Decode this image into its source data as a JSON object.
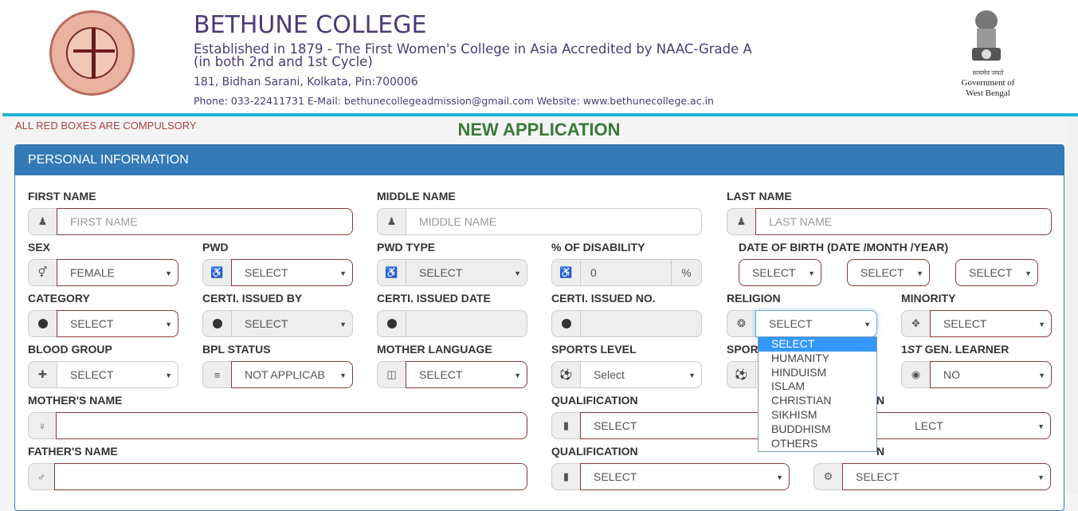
{
  "header": {
    "title": "BETHUNE COLLEGE",
    "subtitle": "Established in 1879 - The First Women's College in Asia Accredited by NAAC-Grade A (in both 2nd and 1st Cycle)",
    "address": "181, Bidhan Sarani, Kolkata, Pin:700006",
    "contact": "Phone: 033-22411731 E-Mail: bethunecollegeadmission@gmail.com Website: www.bethunecollege.ac.in",
    "gov_hindi": "सत्यमेव जयते",
    "gov_line1": "Government of",
    "gov_line2": "West Bengal"
  },
  "notice": "ALL RED BOXES ARE COMPULSORY",
  "page_title": "NEW APPLICATION",
  "panel_title": "PERSONAL INFORMATION",
  "fields": {
    "first_name": {
      "label": "FIRST NAME",
      "placeholder": "FIRST NAME",
      "icon": "user-icon"
    },
    "middle_name": {
      "label": "MIDDLE NAME",
      "placeholder": "MIDDLE NAME",
      "icon": "user-icon"
    },
    "last_name": {
      "label": "LAST NAME",
      "placeholder": "LAST NAME",
      "icon": "user-icon"
    },
    "sex": {
      "label": "SEX",
      "value": "FEMALE",
      "icon": "gender-icon"
    },
    "pwd": {
      "label": "PWD",
      "value": "SELECT",
      "icon": "wheelchair-icon"
    },
    "pwd_type": {
      "label": "PWD TYPE",
      "value": "SELECT",
      "icon": "wheelchair-icon"
    },
    "disability": {
      "label": "% OF DISABILITY",
      "value": "0",
      "suffix": "%",
      "icon": "wheelchair-active-icon"
    },
    "dob": {
      "label": "DATE OF BIRTH (DATE /MONTH /YEAR)",
      "date": "SELECT",
      "month": "SELECT",
      "year": "SELECT"
    },
    "category": {
      "label": "CATEGORY",
      "value": "SELECT",
      "icon": "circle-icon"
    },
    "certi_issued_by": {
      "label": "CERTI. ISSUED BY",
      "value": "SELECT",
      "icon": "circle-icon"
    },
    "certi_issued_date": {
      "label": "CERTI. ISSUED DATE",
      "value": "",
      "icon": "circle-icon"
    },
    "certi_issued_no": {
      "label": "CERTI. ISSUED NO.",
      "value": "",
      "icon": "circle-icon"
    },
    "religion": {
      "label": "RELIGION",
      "value": "SELECT",
      "icon": "religion-icon",
      "options": [
        "SELECT",
        "HUMANITY",
        "HINDUISM",
        "ISLAM",
        "CHRISTIAN",
        "SIKHISM",
        "BUDDHISM",
        "OTHERS"
      ],
      "highlighted": "SELECT"
    },
    "minority": {
      "label": "MINORITY",
      "value": "SELECT",
      "icon": "move-icon"
    },
    "blood_group": {
      "label": "BLOOD GROUP",
      "value": "SELECT",
      "icon": "medkit-icon"
    },
    "bpl_status": {
      "label": "BPL STATUS",
      "value": "NOT APPLICAB",
      "icon": "list-icon"
    },
    "mother_language": {
      "label": "MOTHER LANGUAGE",
      "value": "SELECT",
      "icon": "language-icon"
    },
    "sports_level": {
      "label": "SPORTS LEVEL",
      "value": "Select",
      "icon": "soccer-ball-icon"
    },
    "sports_partial": {
      "label": "SPOR",
      "icon": "soccer-ball-icon"
    },
    "first_gen": {
      "label_pre": "1",
      "label_ital": "ST",
      "label_post": " GEN. LEARNER",
      "value": "NO",
      "icon": "globe-icon"
    },
    "mother_name": {
      "label": "MOTHER'S NAME",
      "value": "",
      "icon": "female-icon"
    },
    "mother_qualification": {
      "label": "QUALIFICATION",
      "value": "SELECT",
      "icon": "book-icon"
    },
    "mother_occupation": {
      "label_partial": "N",
      "value_partial": "LECT"
    },
    "father_name": {
      "label": "FATHER'S NAME",
      "value": "",
      "icon": "male-icon"
    },
    "father_qualification": {
      "label": "QUALIFICATION",
      "value": "SELECT",
      "icon": "book-icon"
    },
    "father_occupation": {
      "label_partial": "N",
      "value": "SELECT",
      "icon": "gears-icon"
    }
  }
}
